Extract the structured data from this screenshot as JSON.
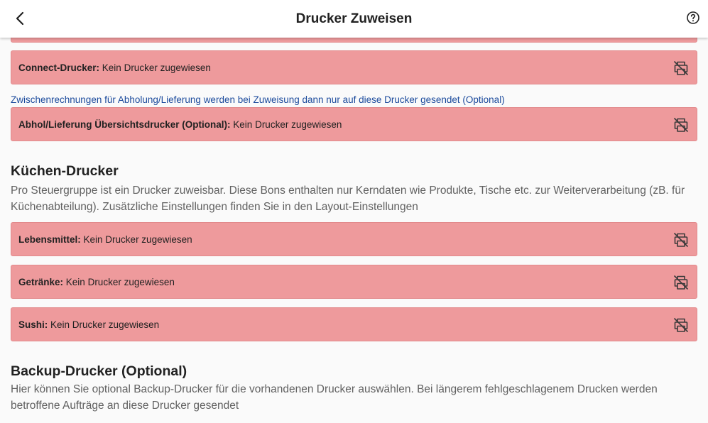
{
  "header": {
    "title": "Drucker Zuweisen",
    "back_icon": "chevron-left-icon",
    "help_icon": "help-circle-icon"
  },
  "status_color": "#ee9a9c",
  "link_color": "#1b4a9c",
  "general": {
    "connect_printer": {
      "label": "Connect-Drucker:",
      "value": "Kein Drucker zugewiesen"
    },
    "pickup_note": "Zwischenrechnungen für Abholung/Lieferung werden bei Zuweisung dann nur auf diese Drucker gesendet (Optional)",
    "pickup_printer": {
      "label": "Abhol/Lieferung Übersichtsdrucker (Optional):",
      "value": "Kein Drucker zugewiesen"
    }
  },
  "kitchen": {
    "title": "Küchen-Drucker",
    "description": "Pro Steuergruppe ist ein Drucker zuweisbar. Diese Bons enthalten nur Kerndaten wie Produkte, Tische etc. zur Weiterverarbeitung (zB. für Küchenabteilung). Zusätzliche Einstellungen finden Sie in den Layout-Einstellungen",
    "items": [
      {
        "label": "Lebensmittel:",
        "value": "Kein Drucker zugewiesen"
      },
      {
        "label": "Getränke:",
        "value": "Kein Drucker zugewiesen"
      },
      {
        "label": "Sushi:",
        "value": "Kein Drucker zugewiesen"
      }
    ]
  },
  "backup": {
    "title": "Backup-Drucker (Optional)",
    "description": "Hier können Sie optional Backup-Drucker für die vorhandenen Drucker auswählen. Bei längerem fehlgeschlagenem Drucken werden betroffene Aufträge an diese Drucker gesendet"
  },
  "printer_status_icon": "printer-off-icon"
}
